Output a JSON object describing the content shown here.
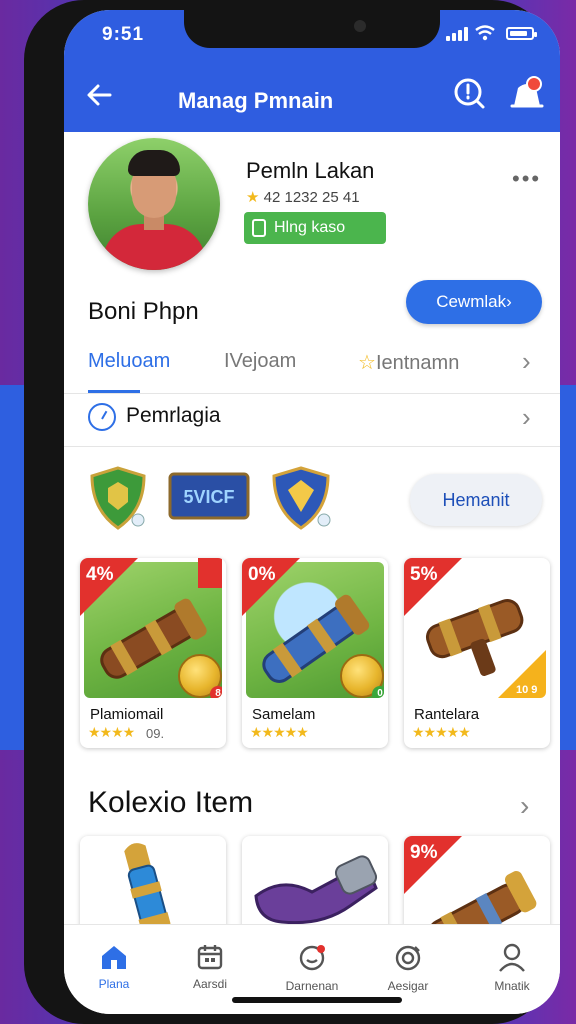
{
  "status": {
    "time": "9:51"
  },
  "header": {
    "title": "Manag Pmnain"
  },
  "profile": {
    "name": "Pemln Lakan",
    "stats": "42 1232 25 41",
    "badge": "Hlng kaso"
  },
  "section": {
    "label": "Boni Phpn",
    "cta": "Cewmlak"
  },
  "tabs": [
    {
      "label": "Meluoam",
      "active": true
    },
    {
      "label": "IVejoam",
      "active": false
    },
    {
      "label": "Ientnamn",
      "active": false
    }
  ],
  "row": {
    "label": "Pemrlagia"
  },
  "badges": {
    "middle_text": "5VICF",
    "button": "Hemanit"
  },
  "cards": [
    {
      "discount": "4%",
      "name": "Plamiomail",
      "stars": "★★★★",
      "extra": "09.",
      "coin_label": "8"
    },
    {
      "discount": "0%",
      "name": "Samelam",
      "stars": "★★★★★",
      "coin_label": "0"
    },
    {
      "discount": "5%",
      "name": "Rantelara",
      "stars": "★★★★★",
      "tag": "10 9"
    }
  ],
  "collection": {
    "title": "Kolexio Item",
    "cards": [
      {
        "discount": ""
      },
      {
        "discount": ""
      },
      {
        "discount": "9%"
      }
    ]
  },
  "nav": [
    {
      "label": "Plana",
      "icon": "home-icon",
      "active": true
    },
    {
      "label": "Aarsdi",
      "icon": "calendar-icon",
      "active": false
    },
    {
      "label": "Darnenan",
      "icon": "chat-icon",
      "active": false
    },
    {
      "label": "Aesigar",
      "icon": "target-icon",
      "active": false
    },
    {
      "label": "Mnatik",
      "icon": "user-icon",
      "active": false
    }
  ],
  "colors": {
    "primary": "#2f5de0",
    "accent": "#2e6fe6",
    "sale": "#e2312d",
    "badge_green": "#4bb54d",
    "star": "#f2b91c"
  }
}
